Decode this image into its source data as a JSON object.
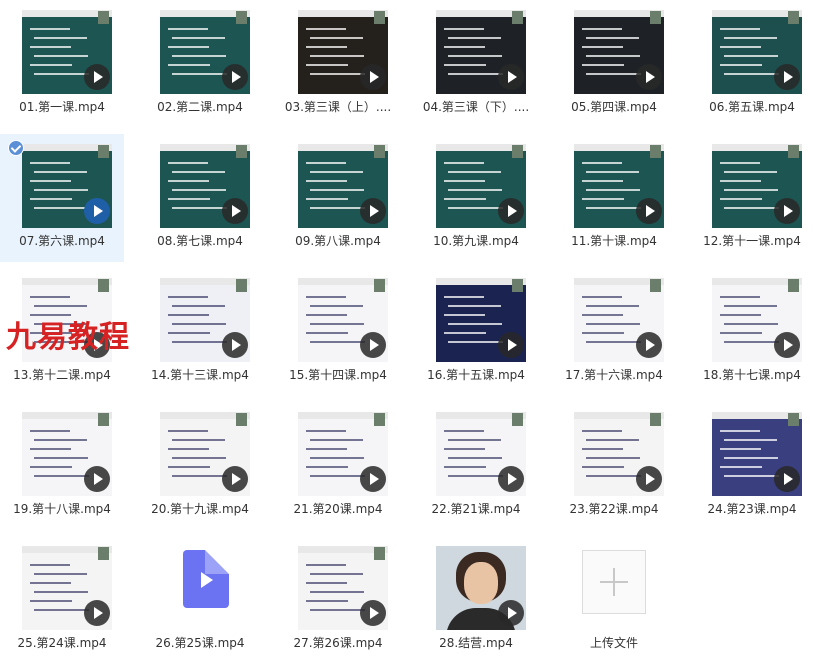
{
  "files": [
    {
      "name": "01.第一课.mp4",
      "style": "green"
    },
    {
      "name": "02.第二课.mp4",
      "style": "green"
    },
    {
      "name": "03.第三课（上）....",
      "style": "ornament"
    },
    {
      "name": "04.第三课（下）....",
      "style": "dark"
    },
    {
      "name": "05.第四课.mp4",
      "style": "dark"
    },
    {
      "name": "06.第五课.mp4",
      "style": "greenlist"
    },
    {
      "name": "07.第六课.mp4",
      "style": "green",
      "selected": true
    },
    {
      "name": "08.第七课.mp4",
      "style": "green"
    },
    {
      "name": "09.第八课.mp4",
      "style": "green"
    },
    {
      "name": "10.第九课.mp4",
      "style": "green"
    },
    {
      "name": "11.第十课.mp4",
      "style": "green"
    },
    {
      "name": "12.第十一课.mp4",
      "style": "green"
    },
    {
      "name": "13.第十二课.mp4",
      "style": "white"
    },
    {
      "name": "14.第十三课.mp4",
      "style": "chartblue"
    },
    {
      "name": "15.第十四课.mp4",
      "style": "white"
    },
    {
      "name": "16.第十五课.mp4",
      "style": "navy"
    },
    {
      "name": "17.第十六课.mp4",
      "style": "white"
    },
    {
      "name": "18.第十七课.mp4",
      "style": "white"
    },
    {
      "name": "19.第十八课.mp4",
      "style": "white"
    },
    {
      "name": "20.第十九课.mp4",
      "style": "chart"
    },
    {
      "name": "21.第20课.mp4",
      "style": "white"
    },
    {
      "name": "22.第21课.mp4",
      "style": "white"
    },
    {
      "name": "23.第22课.mp4",
      "style": "chart"
    },
    {
      "name": "24.第23课.mp4",
      "style": "space"
    },
    {
      "name": "25.第24课.mp4",
      "style": "money"
    },
    {
      "name": "26.第25课.mp4",
      "style": "fileicon"
    },
    {
      "name": "27.第26课.mp4",
      "style": "sunset"
    },
    {
      "name": "28.结营.mp4",
      "style": "person"
    }
  ],
  "upload_label": "上传文件",
  "watermark": "九易教程"
}
